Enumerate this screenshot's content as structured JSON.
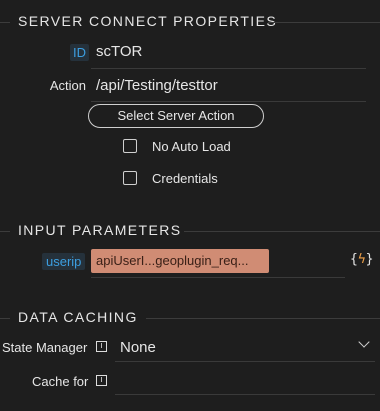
{
  "server_connect": {
    "title": "SERVER CONNECT PROPERTIES",
    "id_label": "ID",
    "id_value": "scTOR",
    "action_label": "Action",
    "action_value": "/api/Testing/testtor",
    "select_action_button": "Select Server Action",
    "no_auto_load_label": "No Auto Load",
    "no_auto_load_checked": false,
    "credentials_label": "Credentials",
    "credentials_checked": false
  },
  "input_parameters": {
    "title": "INPUT PARAMETERS",
    "param_label": "userip",
    "param_value": "apiUserI...geoplugin_req...",
    "dynamic_icon": "dynamic-data-icon"
  },
  "data_caching": {
    "title": "DATA CACHING",
    "state_manager_label": "State Manager",
    "state_manager_value": "None",
    "cache_for_label": "Cache for",
    "cache_for_value": ""
  },
  "colors": {
    "background": "#1e1e1e",
    "accent_blue": "#3c9ee0",
    "expression_fill": "#d08c74"
  }
}
